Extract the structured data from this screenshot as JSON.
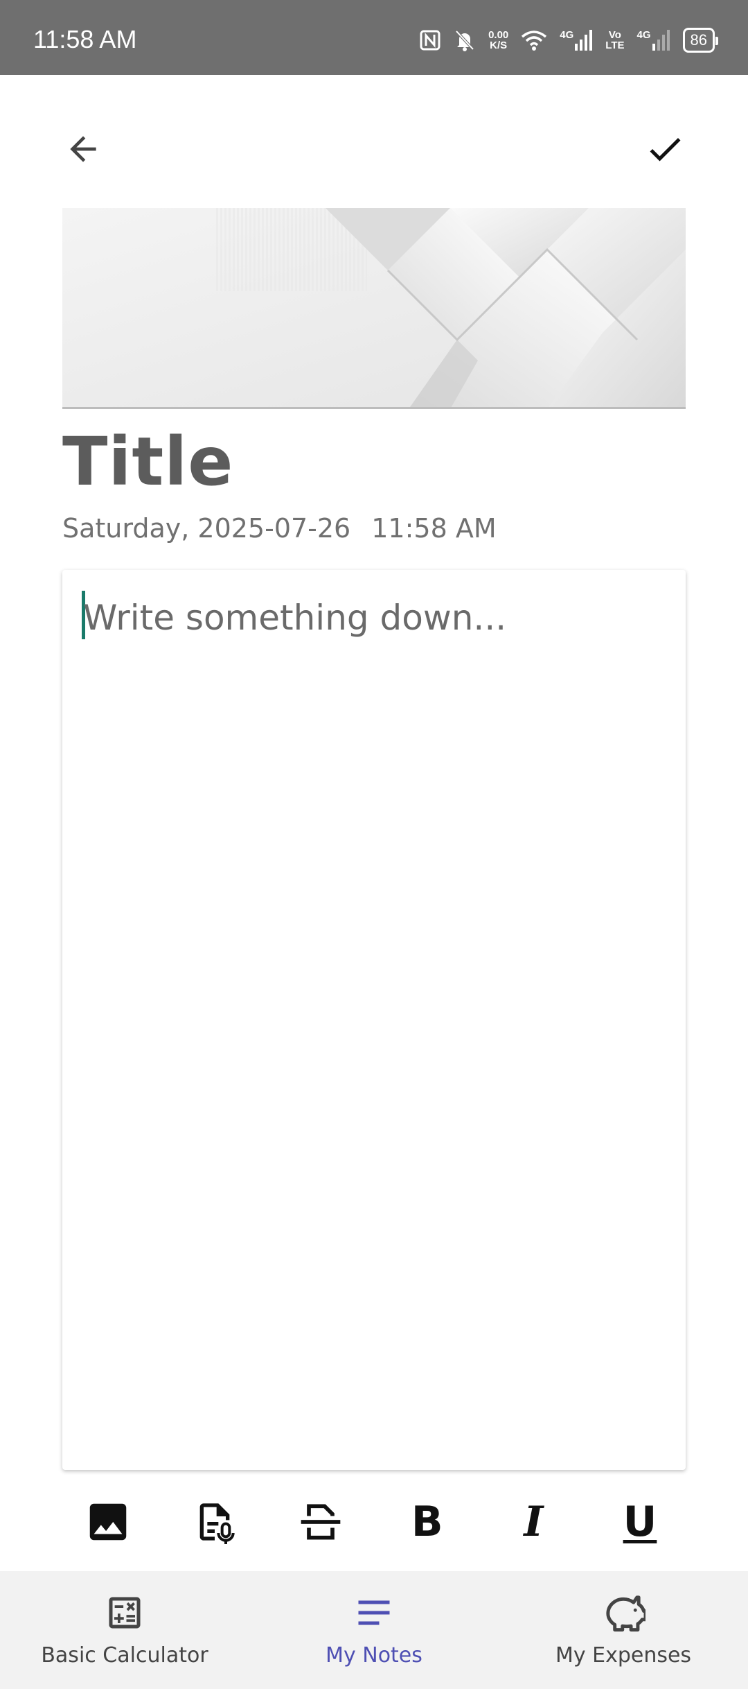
{
  "status_bar": {
    "time": "11:58 AM",
    "net_speed_value": "0.00",
    "net_speed_unit": "K/S",
    "sim1_label": "4G",
    "volte_top": "Vo",
    "volte_bottom": "LTE",
    "sim2_label": "4G",
    "battery": "86"
  },
  "note": {
    "title": "Title",
    "date": "Saturday, 2025-07-26",
    "time": "11:58 AM",
    "body_placeholder": "Write something down..."
  },
  "format_toolbar": {
    "bold": "B",
    "italic": "I",
    "underline": "U"
  },
  "bottom_nav": {
    "items": [
      {
        "label": "Basic Calculator",
        "icon": "calculator-icon"
      },
      {
        "label": "My Notes",
        "icon": "notes-icon",
        "active": true
      },
      {
        "label": "My Expenses",
        "icon": "piggy-bank-icon"
      }
    ]
  },
  "colors": {
    "status_bar": "#6f6f6f",
    "accent": "#4e4fb3",
    "caret": "#1a7a6a"
  }
}
